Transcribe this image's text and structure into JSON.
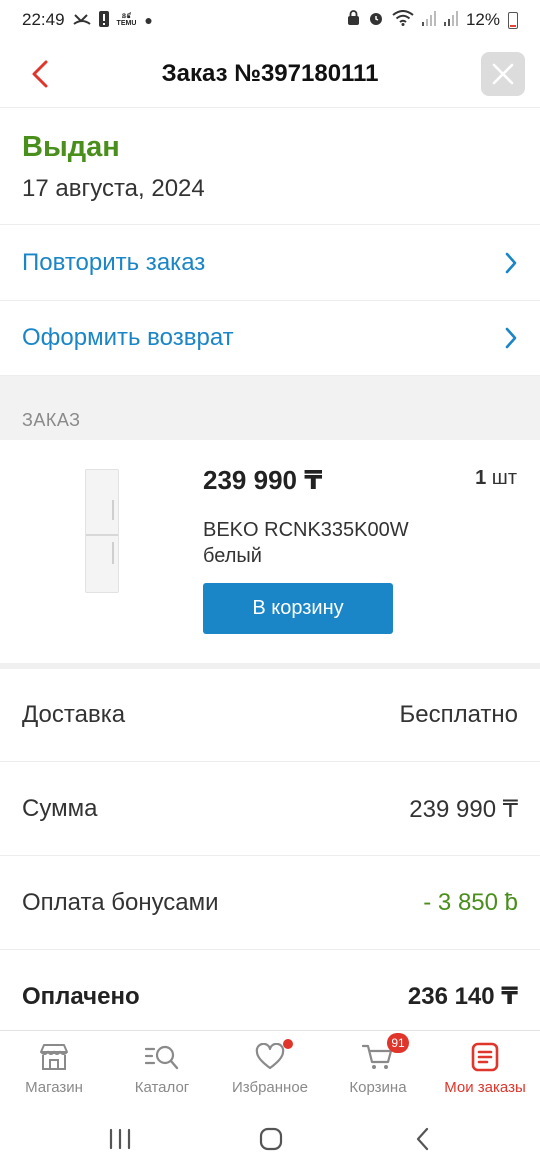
{
  "status_bar": {
    "time": "22:49",
    "temu_line1": "ន៩",
    "temu_line2": "TEMU",
    "battery": "12%"
  },
  "header": {
    "title": "Заказ №397180111"
  },
  "order_status": {
    "status": "Выдан",
    "date": "17 августа, 2024"
  },
  "actions": [
    {
      "label": "Повторить заказ"
    },
    {
      "label": "Оформить возврат"
    }
  ],
  "section_label": "ЗАКАЗ",
  "product": {
    "price": "239 990 ₸",
    "qty_number": "1",
    "qty_unit": "шт",
    "name": "BEKO RCNK335K00W белый",
    "cart_button": "В корзину"
  },
  "summary": [
    {
      "label": "Доставка",
      "value": "Бесплатно"
    },
    {
      "label": "Сумма",
      "value": "239 990 ₸"
    },
    {
      "label": "Оплата бонусами",
      "value": "- 3 850 ƀ"
    },
    {
      "label": "Оплачено",
      "value": "236 140 ₸"
    }
  ],
  "bottom_nav": [
    {
      "label": "Магазин",
      "icon": "shop-icon"
    },
    {
      "label": "Каталог",
      "icon": "catalog-search-icon"
    },
    {
      "label": "Избранное",
      "icon": "heart-icon"
    },
    {
      "label": "Корзина",
      "icon": "cart-icon",
      "badge": "91"
    },
    {
      "label": "Мои заказы",
      "icon": "orders-icon",
      "active": true
    }
  ],
  "colors": {
    "accent_red": "#e0352b",
    "link_blue": "#1a86c7",
    "status_green": "#4a8e1c"
  }
}
